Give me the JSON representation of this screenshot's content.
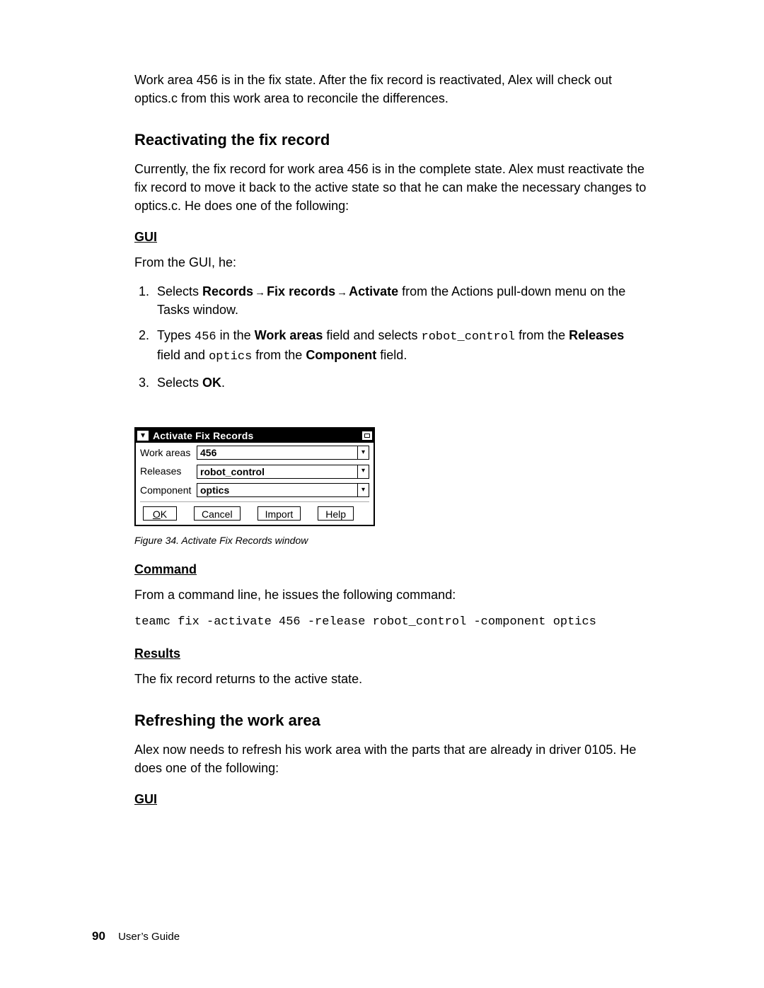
{
  "intro": "Work area 456 is in the fix state. After the fix record is reactivated, Alex will check out optics.c from this work area to reconcile the differences.",
  "section1": {
    "title": "Reactivating the fix record",
    "para": "Currently, the fix record for work area 456 is in the complete state. Alex must reactivate the fix record to move it back to the active state so that he can make the necessary changes to optics.c. He does one of the following:",
    "gui_label": "GUI",
    "gui_intro": "From the GUI, he:",
    "steps": {
      "s1_pre": "Selects ",
      "s1_b1": "Records",
      "s1_b2": "Fix records",
      "s1_b3": "Activate",
      "s1_post": " from the Actions pull-down menu on the Tasks window.",
      "s2_pre": "Types ",
      "s2_code1": "456",
      "s2_mid1": " in the ",
      "s2_b1": "Work areas",
      "s2_mid2": " field and selects ",
      "s2_code2": "robot_control",
      "s2_mid3": " from the ",
      "s2_b2": "Releases",
      "s2_mid4": " field and ",
      "s2_code3": "optics",
      "s2_mid5": " from the ",
      "s2_b3": "Component",
      "s2_post": " field.",
      "s3_pre": "Selects ",
      "s3_b1": "OK",
      "s3_post": "."
    }
  },
  "dialog": {
    "title": "Activate Fix Records",
    "rows": {
      "work_areas_label": "Work areas",
      "work_areas_value": "456",
      "releases_label": "Releases",
      "releases_value": "robot_control",
      "component_label": "Component",
      "component_value": "optics"
    },
    "buttons": {
      "ok_u": "O",
      "ok_rest": "K",
      "cancel": "Cancel",
      "import": "Import",
      "help": "Help"
    }
  },
  "figure_caption": "Figure 34. Activate Fix Records window",
  "command": {
    "label": "Command",
    "intro": "From a command line, he issues the following command:",
    "cmd": "teamc fix -activate 456 -release robot_control -component optics"
  },
  "results": {
    "label": "Results",
    "text": "The fix record returns to the active state."
  },
  "section2": {
    "title": "Refreshing the work area",
    "para": "Alex now needs to refresh his work area with the parts that are already in driver 0105. He does one of the following:",
    "gui_label": "GUI"
  },
  "footer": {
    "page_num": "90",
    "book": "User’s Guide"
  },
  "glyphs": {
    "arrow": "→",
    "sysmenu": "▾",
    "dropdown": "▾"
  }
}
